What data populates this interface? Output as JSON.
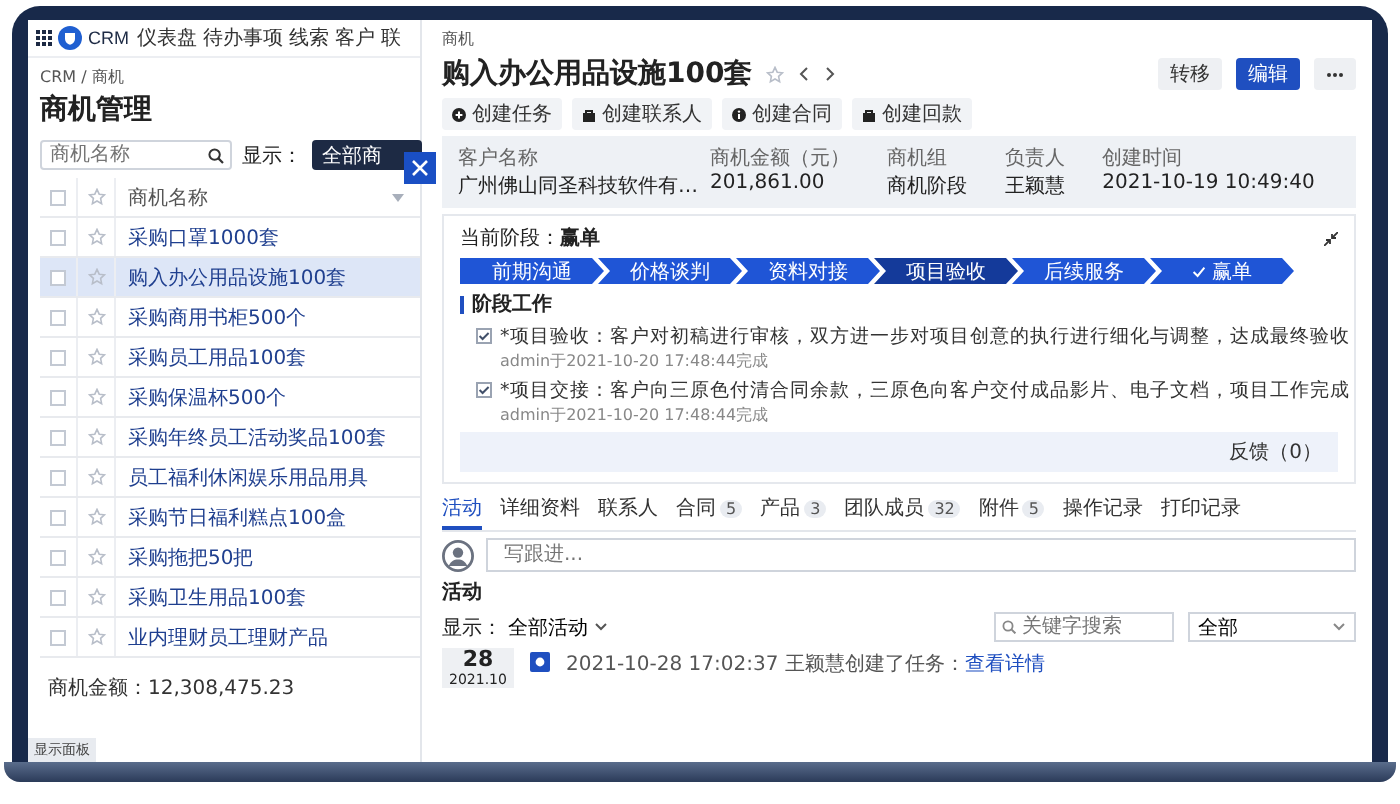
{
  "nav": {
    "app_name": "CRM",
    "items": [
      {
        "label": "仪表盘"
      },
      {
        "label": "待办事项"
      },
      {
        "label": "线索"
      },
      {
        "label": "客户"
      },
      {
        "label": "联"
      }
    ]
  },
  "list_panel": {
    "breadcrumb": "CRM / 商机",
    "title": "商机管理",
    "search": {
      "placeholder": "商机名称"
    },
    "filter_label": "显示：",
    "filter_value": "全部商",
    "columns": [
      "商机名称"
    ],
    "select_all_checked": false,
    "rows": [
      {
        "name": "采购口罩1000套",
        "checked": false,
        "selected": false
      },
      {
        "name": "购入办公用品设施100套",
        "checked": false,
        "selected": true
      },
      {
        "name": "采购商用书柜500个",
        "checked": false,
        "selected": false
      },
      {
        "name": "采购员工用品100套",
        "checked": false,
        "selected": false
      },
      {
        "name": "采购保温杯500个",
        "checked": false,
        "selected": false
      },
      {
        "name": "采购年终员工活动奖品100套",
        "checked": false,
        "selected": false
      },
      {
        "name": "员工福利休闲娱乐用品用具",
        "checked": false,
        "selected": false
      },
      {
        "name": "采购节日福利糕点100盒",
        "checked": false,
        "selected": false
      },
      {
        "name": "采购拖把50把",
        "checked": false,
        "selected": false
      },
      {
        "name": "采购卫生用品100套",
        "checked": false,
        "selected": false
      },
      {
        "name": "业内理财员工理财产品",
        "checked": false,
        "selected": false
      }
    ],
    "total": "商机金额：12,308,475.23",
    "corner_label": "显示面板"
  },
  "detail": {
    "kicker": "商机",
    "title": "购入办公用品设施100套",
    "buttons": [
      {
        "label": "转移",
        "kind": "default"
      },
      {
        "label": "编辑",
        "kind": "primary"
      }
    ],
    "actions": [
      {
        "label": "创建任务",
        "kind": "circle"
      },
      {
        "label": "创建联系人",
        "kind": "bag"
      },
      {
        "label": "创建合同",
        "kind": "info"
      },
      {
        "label": "创建回款",
        "kind": "bag"
      }
    ],
    "summary": [
      {
        "label": "客户名称",
        "value": "广州佛山同圣科技软件有…"
      },
      {
        "label": "商机金额（元）",
        "value": "201,861.00"
      },
      {
        "label": "商机组",
        "value": "商机阶段"
      },
      {
        "label": "负责人",
        "value": "王颖慧"
      },
      {
        "label": "创建时间",
        "value": "2021-10-19 10:49:40"
      }
    ],
    "stage": {
      "label": "当前阶段：",
      "value": "赢单",
      "steps": [
        {
          "label": "前期沟通",
          "highlighted": false,
          "won": false
        },
        {
          "label": "价格谈判",
          "highlighted": false,
          "won": false
        },
        {
          "label": "资料对接",
          "highlighted": false,
          "won": false
        },
        {
          "label": "项目验收",
          "highlighted": true,
          "won": false
        },
        {
          "label": "后续服务",
          "highlighted": false,
          "won": false
        },
        {
          "label": "赢单",
          "highlighted": false,
          "won": true
        }
      ],
      "section_title": "阶段工作",
      "tasks": [
        {
          "text": "*项目验收：客户对初稿进行审核，双方进一步对项目创意的执行进行细化与调整，达成最终验收",
          "meta": "admin于2021-10-20 17:48:44完成",
          "checked": true
        },
        {
          "text": "*项目交接：客户向三原色付清合同余款，三原色向客户交付成品影片、电子文档，项目工作完成",
          "meta": "admin于2021-10-20 17:48:44完成",
          "checked": true
        }
      ],
      "feedback": "反馈（0）"
    },
    "tabs": [
      {
        "label": "活动",
        "selected": true
      },
      {
        "label": "详细资料",
        "selected": false
      },
      {
        "label": "联系人",
        "selected": false
      },
      {
        "label": "合同",
        "count": "5",
        "selected": false
      },
      {
        "label": "产品",
        "count": "3",
        "selected": false
      },
      {
        "label": "团队成员",
        "count": "32",
        "selected": false
      },
      {
        "label": "附件",
        "count": "5",
        "selected": false
      },
      {
        "label": "操作记录",
        "selected": false
      },
      {
        "label": "打印记录",
        "selected": false
      }
    ],
    "composer": {
      "placeholder": "写跟进..."
    },
    "activity": {
      "title": "活动",
      "filter_label": "显示：",
      "filter_value": "全部活动",
      "search": {
        "placeholder": "关键字搜索"
      },
      "type_select": "全部",
      "entries": [
        {
          "day": "28",
          "month": "2021.10",
          "text": "2021-10-28 17:02:37 王颖慧创建了任务：",
          "link": "查看详情"
        }
      ]
    }
  }
}
